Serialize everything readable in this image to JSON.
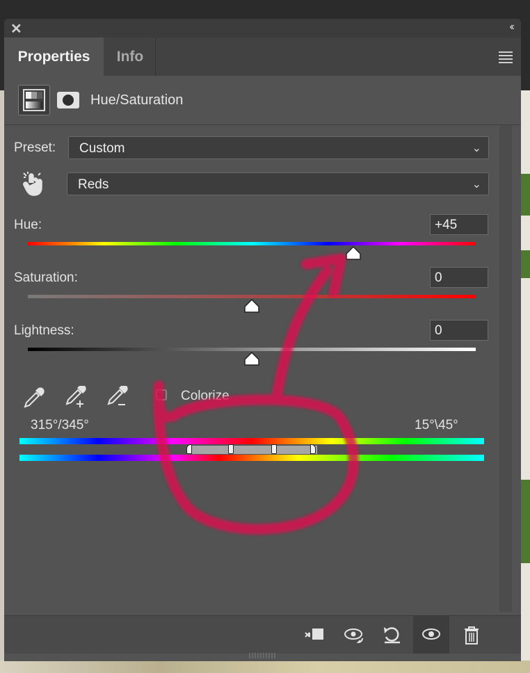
{
  "tabs": [
    {
      "label": "Properties",
      "active": true
    },
    {
      "label": "Info",
      "active": false
    }
  ],
  "adjustment": {
    "title": "Hue/Saturation"
  },
  "preset": {
    "label": "Preset:",
    "value": "Custom"
  },
  "channel": {
    "value": "Reds"
  },
  "hue": {
    "label": "Hue:",
    "value": "+45"
  },
  "saturation": {
    "label": "Saturation:",
    "value": "0"
  },
  "lightness": {
    "label": "Lightness:",
    "value": "0"
  },
  "colorize": {
    "label": "Colorize",
    "checked": false
  },
  "range": {
    "left": "315°/345°",
    "right": "15°\\45°"
  },
  "icons": {
    "close": "close-icon",
    "collapse": "double-chevron-icon",
    "menu": "panel-menu-icon",
    "targeted": "targeted-adjustment-hand-icon",
    "footer": [
      "clip-to-layer-icon",
      "view-previous-state-icon",
      "reset-icon",
      "visibility-eye-icon",
      "trash-icon"
    ]
  },
  "colors": {
    "panel": "#535353",
    "annotation": "#e0104f"
  }
}
